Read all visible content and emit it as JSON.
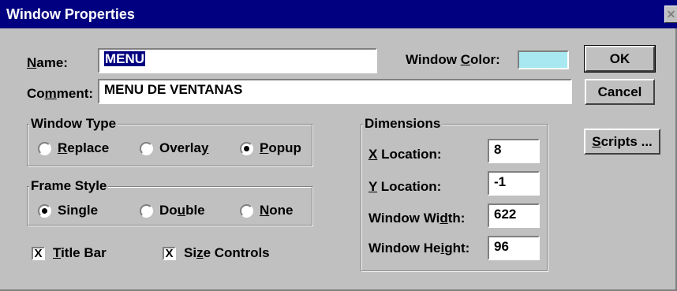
{
  "window": {
    "title": "Window Properties",
    "close_glyph": "✕"
  },
  "name_field": {
    "label_pre": "",
    "label_u": "N",
    "label_post": "ame:",
    "value": "MENU"
  },
  "comment_field": {
    "label_pre": "Co",
    "label_u": "m",
    "label_post": "ment:",
    "value": "MENU DE VENTANAS"
  },
  "window_color": {
    "label_pre": "Window ",
    "label_u": "C",
    "label_post": "olor:",
    "color": "#a8e8f0"
  },
  "buttons": {
    "ok": "OK",
    "cancel": "Cancel",
    "scripts_u": "S",
    "scripts_post": "cripts ..."
  },
  "window_type": {
    "title": "Window Type",
    "options": [
      {
        "u": "R",
        "post": "eplace",
        "selected": false
      },
      {
        "pre": "Overla",
        "u": "y",
        "selected": false
      },
      {
        "u": "P",
        "post": "opup",
        "selected": true
      }
    ]
  },
  "frame_style": {
    "title": "Frame Style",
    "options": [
      {
        "pre": "Sin",
        "u": "g",
        "post": "le",
        "selected": true
      },
      {
        "pre": "Do",
        "u": "u",
        "post": "ble",
        "selected": false
      },
      {
        "u": "N",
        "post": "one",
        "selected": false
      }
    ]
  },
  "checkboxes": {
    "title_bar": {
      "u": "T",
      "post": "itle Bar",
      "checked": true,
      "mark": "X"
    },
    "size_controls": {
      "pre": "Si",
      "u": "z",
      "post": "e Controls",
      "checked": true,
      "mark": "X"
    }
  },
  "dimensions": {
    "title": "Dimensions",
    "x_location": {
      "u": "X",
      "post": " Location:",
      "value": "8"
    },
    "y_location": {
      "u": "Y",
      "post": " Location:",
      "value": "-1"
    },
    "window_width": {
      "pre": "Window Wi",
      "u": "d",
      "post": "th:",
      "value": "622"
    },
    "window_height": {
      "pre": "Window He",
      "u": "i",
      "post": "ght:",
      "value": "96"
    }
  }
}
